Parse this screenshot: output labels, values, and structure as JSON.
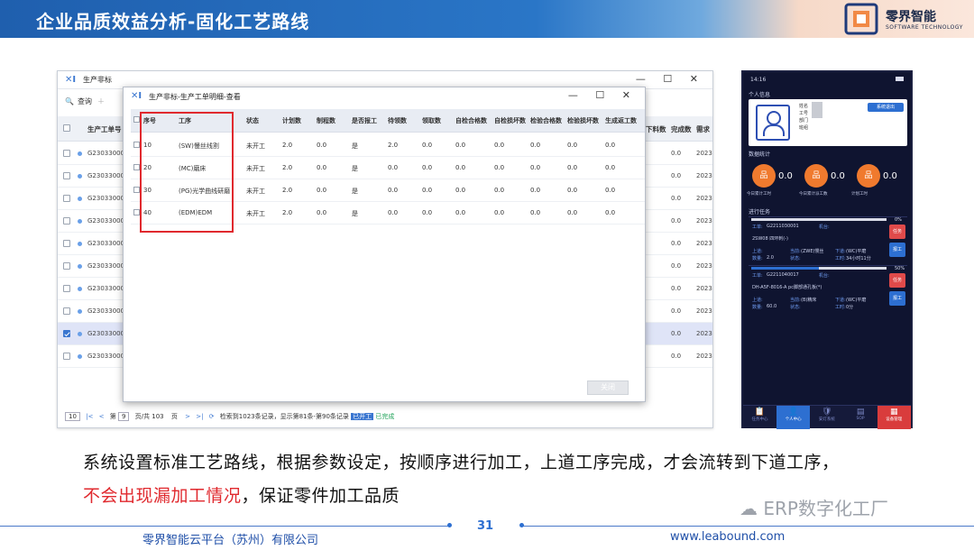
{
  "header": {
    "title": "企业品质效益分析-固化工艺路线",
    "logo_name": "零界智能",
    "logo_sub": "SOFTWARE TECHNOLOGY",
    "colors": {
      "band_start": "#1f5fae",
      "band_end": "#fbe7dc"
    }
  },
  "bg_window": {
    "title": "生产非标",
    "toolbar_query": "查询",
    "header_code": "生产工单号",
    "header_c1": "完成数",
    "header_c2": "需求",
    "header_extra": "下料数",
    "rows": [
      {
        "code": "G2303300098",
        "c1": "0.0",
        "c2": "2023"
      },
      {
        "code": "G2303300097",
        "c1": "0.0",
        "c2": "2023"
      },
      {
        "code": "G2303300096",
        "c1": "0.0",
        "c2": "2023"
      },
      {
        "code": "G2303300095",
        "c1": "0.0",
        "c2": "2023"
      },
      {
        "code": "G2303300094",
        "c1": "0.0",
        "c2": "2023"
      },
      {
        "code": "G2303300093",
        "c1": "0.0",
        "c2": "2023"
      },
      {
        "code": "G2303300092",
        "c1": "0.0",
        "c2": "2023"
      },
      {
        "code": "G2303300091",
        "c1": "0.0",
        "c2": "2023"
      },
      {
        "code": "G2303300090",
        "c1": "0.0",
        "c2": "2023"
      },
      {
        "code": "G2303300089",
        "c1": "0.0",
        "c2": "2023"
      }
    ],
    "pager": {
      "page_size": "10",
      "page_label": "第",
      "page": "9",
      "total_label": "页/共 103",
      "page_unit": "页",
      "records": "检索到1023条记录，显示第81条-第90条记录",
      "status_a": "已开工",
      "status_b": "已完成"
    }
  },
  "modal": {
    "title": "生产非标-生产工单明细-查看",
    "columns": [
      "序号",
      "工序",
      "状态",
      "计划数",
      "制程数",
      "是否报工",
      "待领数",
      "领取数",
      "自检合格数",
      "自检损坏数",
      "检验合格数",
      "检验损坏数",
      "生成返工数"
    ],
    "rows": [
      [
        "10",
        "(SW)慢丝线割",
        "未开工",
        "2.0",
        "0.0",
        "是",
        "2.0",
        "0.0",
        "0.0",
        "0.0",
        "0.0",
        "0.0",
        "0.0"
      ],
      [
        "20",
        "(MC)磨床",
        "未开工",
        "2.0",
        "0.0",
        "是",
        "0.0",
        "0.0",
        "0.0",
        "0.0",
        "0.0",
        "0.0",
        "0.0"
      ],
      [
        "30",
        "(PG)光学曲线研磨",
        "未开工",
        "2.0",
        "0.0",
        "是",
        "0.0",
        "0.0",
        "0.0",
        "0.0",
        "0.0",
        "0.0",
        "0.0"
      ],
      [
        "40",
        "(EDM)EDM",
        "未开工",
        "2.0",
        "0.0",
        "是",
        "0.0",
        "0.0",
        "0.0",
        "0.0",
        "0.0",
        "0.0",
        "0.0"
      ]
    ],
    "close_label": "关闭"
  },
  "phone": {
    "status_time": "14:16",
    "section_personal": "个人信息",
    "field_name": "姓名",
    "field_id": "工号",
    "field_dept": "部门",
    "field_group": "班组",
    "logout": "系统退出",
    "section_stats": "数据统计",
    "stats": [
      {
        "value": "0.0",
        "label": "今日累计工时"
      },
      {
        "value": "0.0",
        "label": "今日累计派工数"
      },
      {
        "value": "0.0",
        "label": "计划工时"
      }
    ],
    "section_tasks": "进行任务",
    "tasks": [
      {
        "progress": 0,
        "pct": "0%",
        "order_label": "工单:",
        "order": "G2211030001",
        "machine_label": "机台:",
        "part": "2SW08 四环刺(-)",
        "up_label": "上道:",
        "prev_label": "当前:",
        "prev": "(ZWE)慢丝",
        "next_label": "下道:",
        "next": "(WC)平磨",
        "qty_label": "数量:",
        "qty": "2.0",
        "state_label": "状态:",
        "time_label": "工时:",
        "time": "34小时11分",
        "btn1": "任务",
        "btn2": "报工"
      },
      {
        "progress": 50,
        "pct": "50%",
        "order_label": "工单:",
        "order": "G2211040017",
        "machine_label": "机台:",
        "part": "DH-A5F-8016-A pc脚部通孔板(*)",
        "up_label": "上道:",
        "prev_label": "当前:",
        "prev": "(B)精床",
        "next_label": "下道:",
        "next": "(WC)平磨",
        "qty_label": "数量:",
        "qty": "60.0",
        "state_label": "状态:",
        "time_label": "工时:",
        "time": "0分",
        "btn1": "任务",
        "btn2": "报工"
      }
    ],
    "tabs": [
      "任务中心",
      "个人中心",
      "安灯系统",
      "SOP",
      "设备管理"
    ]
  },
  "caption": {
    "line1": "系统设置标准工艺路线，根据参数设定，按顺序进行加工，上道工序完成，才会流转到下道工序，",
    "line2_red": "不会出现漏加工情况",
    "line2_rest": "，保证零件加工品质"
  },
  "watermark": "ERP数字化工厂",
  "footer": {
    "company": "零界智能云平台（苏州）有限公司",
    "page": "31",
    "site": "www.leabound.com"
  }
}
